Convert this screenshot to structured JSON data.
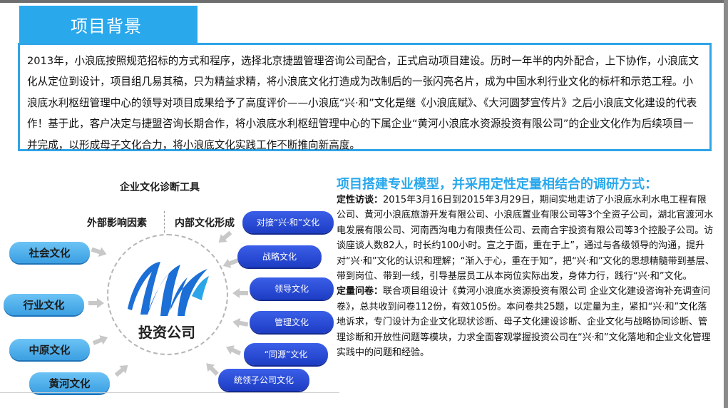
{
  "section": {
    "title": "项目背景",
    "paragraph": "2013年，小浪底按照规范招标的方式和程序，选择北京捷盟管理咨询公司配合，正式启动项目建设。历时一年半的内外配合，上下协作，小浪底文化从定位到设计，项目组几易其稿，只为精益求精，将小浪底文化打造成为改制后的一张闪亮名片，成为中国水利行业文化的标杆和示范工程。小浪底水利枢纽管理中心的领导对项目成果给予了高度评价——小浪底“兴·和”文化是继《小浪底赋》、《大河圆梦宣传片》之后小浪底文化建设的代表作！基于此，客户决定与捷盟咨询长期合作，将小浪底水利枢纽管理中心的下属企业“黄河小浪底水资源投资有限公司”的企业文化作为后续项目一并完成，以形成母子文化合力，将小浪底文化实践工作不断推向新高度。"
  },
  "diagram": {
    "title": "企业文化诊断工具",
    "external_label": "外部影响因素",
    "internal_label": "内部文化形成",
    "center": "投资公司",
    "external_items": [
      "社会文化",
      "行业文化",
      "中原文化",
      "黄河文化"
    ],
    "internal_items": [
      "对接“兴·和”文化",
      "战略文化",
      "领导文化",
      "管理文化",
      "“同源”文化",
      "统领子公司文化"
    ],
    "colors": {
      "external": "#3a9fe2",
      "internal": "#1d3cc4",
      "logo_blue": "#1b6fd6",
      "logo_cyan": "#2aa6e8"
    }
  },
  "method": {
    "heading": "项目搭建专业模型，并采用定性定量相结合的调研方式：",
    "interview_label": "定性访谈：",
    "interview_text": "2015年3月16日到2015年3月29日，期间实地走访了小浪底水利水电工程有限公司、黄河小浪底旅游开发有限公司、小浪底置业有限公司等3个全资子公司，湖北官渡河水电发展有限公司、河南西沟电力有限责任公司、云南合宇投资有限公司等3个控股子公司。访谈座谈人数82人，时长约100小时。宣之于面，重在于上”，通过与各级领导的沟通，提升对“兴·和”文化的认识和理解；“渐入于心，重在于知”，把“兴·和”文化的思想精髓带到基层、带到岗位、带到一线，引导基层员工从本岗位实际出发，身体力行，践行“兴·和”文化。",
    "survey_label": "定量问卷：",
    "survey_text": "联合项目组设计《黄河小浪底水资源投资有限公司 企业文化建设咨询补充调查问卷》，总共收到问卷112份，有效105份。本问卷共25题，以定量为主，紧扣“兴·和”文化落地诉求，专门设计为企业文化现状诊断、母子文化建设诊断、企业文化与战略协同诊断、管理诊断和开放性问题等模块，力求全面客观掌握投资公司在“兴·和”文化落地和企业文化管理实践中的问题和经验。"
  }
}
